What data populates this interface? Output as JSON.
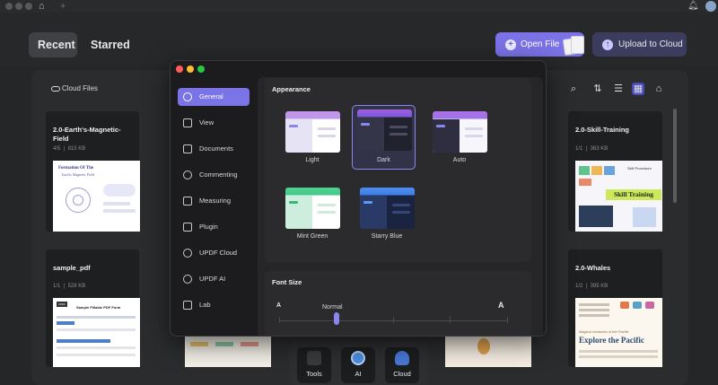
{
  "app": {
    "tabs": [
      {
        "label": "Recent"
      },
      {
        "label": "Starred"
      }
    ],
    "buttons": {
      "open_file": "Open File",
      "upload": "Upload to Cloud"
    },
    "cloud_files": "Cloud Files",
    "files": [
      {
        "title": "2.0-Earth's-Magnetic-Field",
        "pages": "4/5",
        "size": "815 KB",
        "thumb_heading": "Formation Of The",
        "thumb_sub": "Earth's Magnetic Field"
      },
      {
        "title": "2.0-Skill-Training",
        "pages": "1/1",
        "size": "363 KB",
        "thumb_heading": "Skill Training",
        "thumb_sub": "Skill Procedure"
      },
      {
        "title": "sample_pdf",
        "pages": "1/1",
        "size": "528 KB",
        "thumb_heading": "Sample Fillable PDF Form",
        "thumb_sub": "UPDF"
      },
      {
        "title": "2.0-Whales",
        "pages": "1/2",
        "size": "395 KB",
        "thumb_heading": "Explore the Pacific",
        "thumb_sub": "Magical creatures of the Pacific"
      }
    ],
    "dock": [
      {
        "label": "Tools"
      },
      {
        "label": "AI"
      },
      {
        "label": "Cloud"
      }
    ]
  },
  "prefs": {
    "sidebar": [
      {
        "label": "General"
      },
      {
        "label": "View"
      },
      {
        "label": "Documents"
      },
      {
        "label": "Commenting"
      },
      {
        "label": "Measuring"
      },
      {
        "label": "Plugin"
      },
      {
        "label": "UPDF Cloud"
      },
      {
        "label": "UPDF AI"
      },
      {
        "label": "Lab"
      }
    ],
    "appearance": {
      "heading": "Appearance",
      "themes": [
        {
          "label": "Light"
        },
        {
          "label": "Dark"
        },
        {
          "label": "Auto"
        },
        {
          "label": "Mint Green"
        },
        {
          "label": "Starry Blue"
        }
      ],
      "selected": "Dark"
    },
    "font_size": {
      "heading": "Font Size",
      "min": "A",
      "max": "A",
      "current": "Normal",
      "level_fraction": 0.25
    }
  },
  "colors": {
    "accent": "#7b74e6",
    "upload_btn": "#3c3d5e"
  }
}
